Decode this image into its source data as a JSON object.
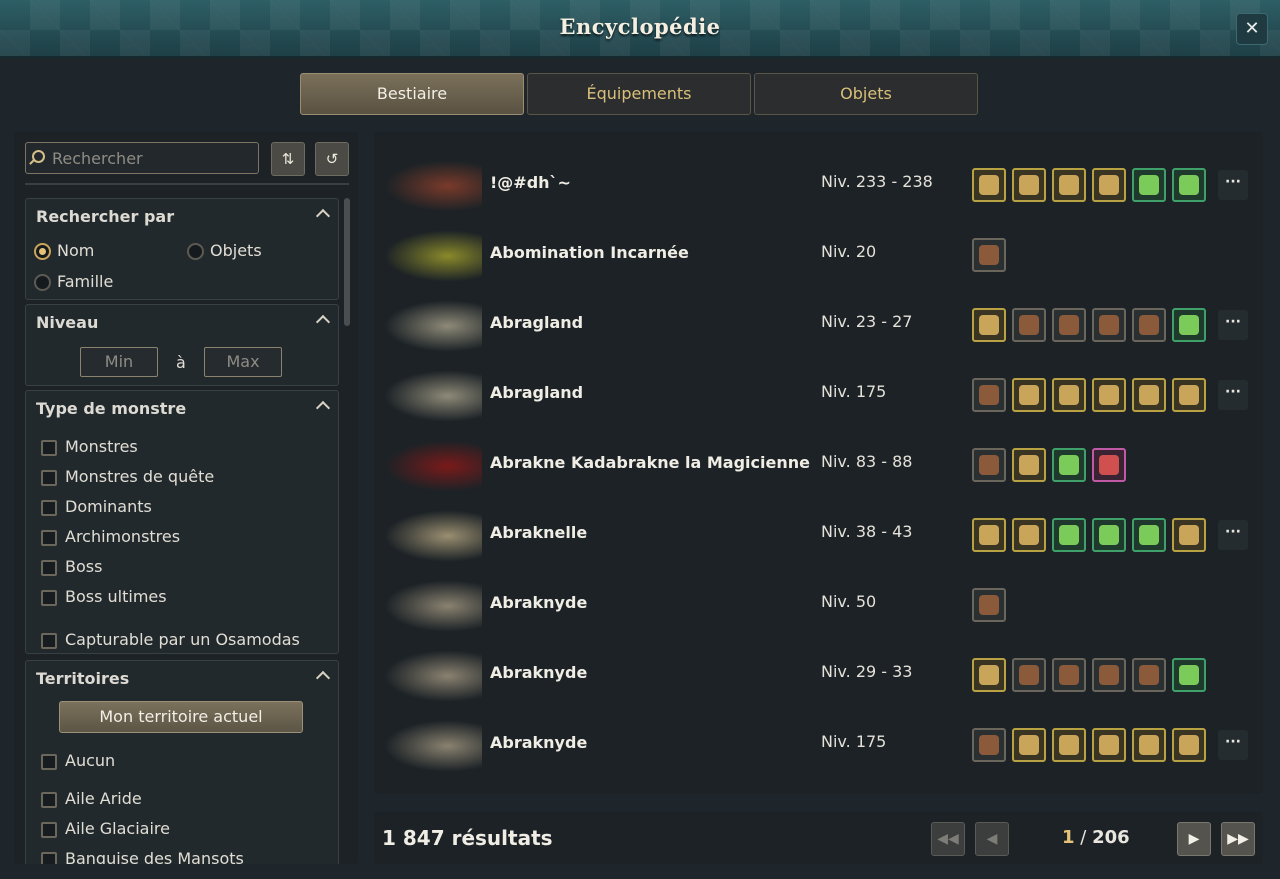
{
  "window": {
    "title": "Encyclopédie",
    "close_label": "✕"
  },
  "tabs": [
    {
      "label": "Bestiaire",
      "active": true
    },
    {
      "label": "Équipements",
      "active": false
    },
    {
      "label": "Objets",
      "active": false
    }
  ],
  "sidebar": {
    "search_placeholder": "Rechercher",
    "search_by": {
      "title": "Rechercher par",
      "options": [
        "Nom",
        "Objets",
        "Famille"
      ],
      "selected": "Nom"
    },
    "level": {
      "title": "Niveau",
      "min_placeholder": "Min",
      "separator": "à",
      "max_placeholder": "Max"
    },
    "monster_type": {
      "title": "Type de monstre",
      "options": [
        "Monstres",
        "Monstres de quête",
        "Dominants",
        "Archimonstres",
        "Boss",
        "Boss ultimes",
        "Capturable par un Osamodas"
      ]
    },
    "territories": {
      "title": "Territoires",
      "current_button": "Mon territoire actuel",
      "options": [
        "Aucun",
        "Aile Aride",
        "Aile Glaciaire",
        "Banquise des Mansots"
      ]
    }
  },
  "monsters": [
    {
      "name": "!@#dh`~",
      "level": "Niv. 233 - 238",
      "drops": [
        "gold",
        "gold",
        "gold",
        "gold",
        "green",
        "green"
      ],
      "more": true
    },
    {
      "name": "Abomination Incarnée",
      "level": "Niv. 20",
      "drops": [
        "gray"
      ],
      "more": false
    },
    {
      "name": "Abragland",
      "level": "Niv. 23 - 27",
      "drops": [
        "gold",
        "gray",
        "gray",
        "gray",
        "gray",
        "green"
      ],
      "more": true
    },
    {
      "name": "Abragland",
      "level": "Niv. 175",
      "drops": [
        "gray",
        "gold",
        "gold",
        "gold",
        "gold",
        "gold"
      ],
      "more": true
    },
    {
      "name": "Abrakne Kadabrakne la Magicienne",
      "level": "Niv. 83 - 88",
      "drops": [
        "gray",
        "gold",
        "green",
        "pink"
      ],
      "more": false
    },
    {
      "name": "Abraknelle",
      "level": "Niv. 38 - 43",
      "drops": [
        "gold",
        "gold",
        "green",
        "green",
        "green",
        "gold"
      ],
      "more": true
    },
    {
      "name": "Abraknyde",
      "level": "Niv. 50",
      "drops": [
        "gray"
      ],
      "more": false
    },
    {
      "name": "Abraknyde",
      "level": "Niv. 29 - 33",
      "drops": [
        "gold",
        "gray",
        "gray",
        "gray",
        "gray",
        "green"
      ],
      "more": false
    },
    {
      "name": "Abraknyde",
      "level": "Niv. 175",
      "drops": [
        "gray",
        "gold",
        "gold",
        "gold",
        "gold",
        "gold"
      ],
      "more": true
    }
  ],
  "footer": {
    "results": "1 847 résultats",
    "current_page": "1",
    "page_sep": "/",
    "total_pages": "206"
  },
  "colors": {
    "accent": "#e5c27a",
    "header": "#2e5f66",
    "panel": "#1c2226"
  }
}
